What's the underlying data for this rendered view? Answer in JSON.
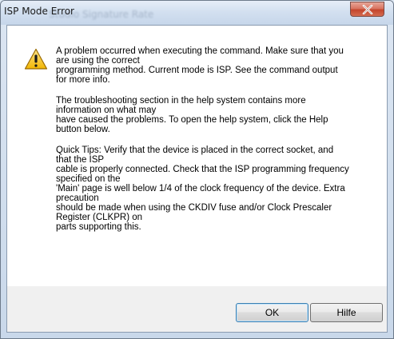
{
  "window": {
    "title": "ISP Mode Error",
    "background_title_ghost": "Studio Signature Rate"
  },
  "message": {
    "paragraphs": [
      {
        "lines": [
          "A problem occurred when executing the command. Make sure that you",
          "are using the correct",
          "programming method. Current mode is ISP. See the command output",
          "for more info."
        ]
      },
      {
        "lines": [
          "The troubleshooting section in the help system contains more",
          "information on what may",
          "have caused the problems. To open the help system, click the Help",
          "button below."
        ]
      },
      {
        "lines": [
          "Quick Tips: Verify that the device is placed in the correct socket, and",
          "that the ISP",
          "cable is properly connected. Check that the ISP programming frequency",
          "specified on the",
          "'Main' page is well below 1/4 of the clock frequency of the device. Extra",
          "precaution",
          "should be made when using the CKDIV fuse and/or Clock Prescaler",
          "Register (CLKPR) on",
          "parts supporting this."
        ]
      }
    ]
  },
  "buttons": {
    "ok_label": "OK",
    "help_label": "Hilfe"
  },
  "icons": {
    "warning": "warning-icon",
    "close": "close-icon"
  },
  "colors": {
    "close_button": "#c4452c",
    "warning_fill": "#f5c518",
    "message_background": "#ffffff",
    "dialog_background": "#f0f0f0"
  }
}
